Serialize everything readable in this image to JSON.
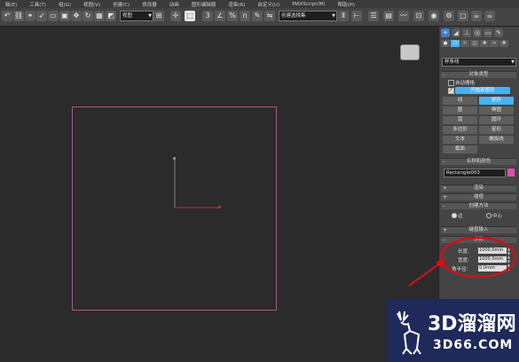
{
  "menubar": {
    "items": [
      "辑(E)",
      "工具(T)",
      "组(G)",
      "视图(V)",
      "创建(C)",
      "修改器",
      "动画",
      "图形编辑器",
      "渲染(R)",
      "自定义(U)",
      "MAXScript(M)",
      "帮助(H)"
    ]
  },
  "toolbar": {
    "view_dropdown": "视图",
    "selection_set_dropdown": "创建选择集",
    "snap_labels": [
      "3",
      "%",
      "n"
    ]
  },
  "panel": {
    "category_dropdown": "样条线",
    "object_type": {
      "title": "对象类型",
      "autogrid": "自动栅格",
      "start_new_shape": "开始新图形",
      "buttons": [
        {
          "label": "线",
          "selected": false
        },
        {
          "label": "矩形",
          "selected": true
        },
        {
          "label": "圆",
          "selected": false
        },
        {
          "label": "椭圆",
          "selected": false
        },
        {
          "label": "弧",
          "selected": false
        },
        {
          "label": "圆环",
          "selected": false
        },
        {
          "label": "多边形",
          "selected": false
        },
        {
          "label": "星形",
          "selected": false
        },
        {
          "label": "文本",
          "selected": false
        },
        {
          "label": "螺旋线",
          "selected": false
        },
        {
          "label": "截面",
          "selected": false
        }
      ]
    },
    "name_color": {
      "title": "名称和颜色",
      "name": "Rectangle003",
      "color": "#e04fb0"
    },
    "rollouts": {
      "render": "渲染",
      "interpolation": "插值",
      "creation_method": "创建方法",
      "keyboard_entry": "键盘输入",
      "parameters": "参数"
    },
    "creation_method": {
      "edge": "边",
      "center": "中心"
    },
    "parameters": {
      "length_label": "长度:",
      "length_value": "1000.0mm",
      "width_label": "宽度:",
      "width_value": "1000.0mm",
      "corner_radius_label": "角半径:",
      "corner_radius_value": "0.0mm"
    }
  },
  "watermark": {
    "brand": "3D溜溜网",
    "url": "3D66.COM"
  },
  "colors": {
    "rectangle_outline": "#b84e88",
    "annotation_red": "#d0101a",
    "accent_blue": "#4cb0f0"
  }
}
